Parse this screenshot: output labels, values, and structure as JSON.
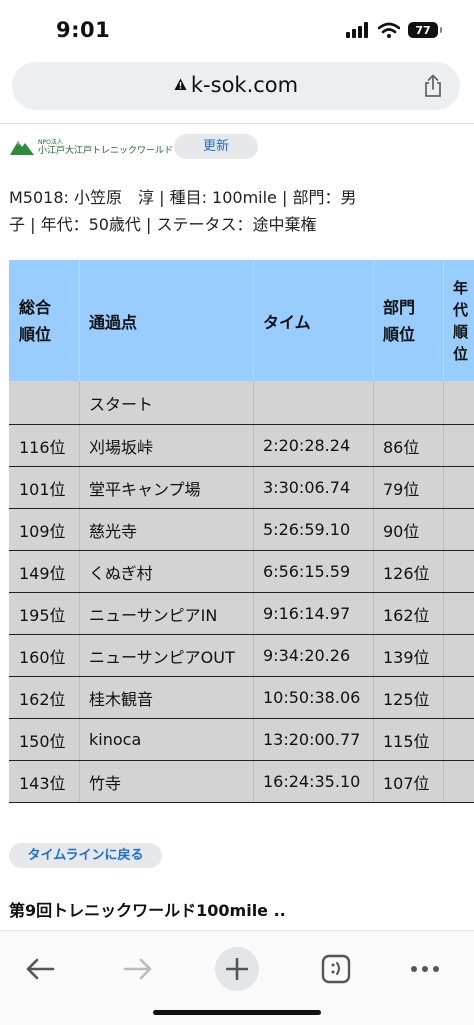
{
  "status_bar": {
    "time": "9:01",
    "battery": "77"
  },
  "browser": {
    "url": "k-sok.com"
  },
  "site": {
    "logo_small": "NPO法人",
    "logo_main": "小江戸大江戸トレニックワールド",
    "update_label": "更新"
  },
  "runner": {
    "line1": "M5018: 小笠原　淳 | 種目: 100mile | 部門：男",
    "line2": "子 | 年代：50歳代 | ステータス：途中棄権"
  },
  "table": {
    "headers": {
      "rank_l1": "総合",
      "rank_l2": "順位",
      "point": "通過点",
      "time": "タイム",
      "div_l1": "部門",
      "div_l2": "順位",
      "age_l1": "年",
      "age_l2": "代",
      "age_l3": "順",
      "age_l4": "位"
    },
    "start": "スタート",
    "rows": [
      {
        "rank": "116位",
        "point": "刈場坂峠",
        "time": "2:20:28.24",
        "division_rank": "86位"
      },
      {
        "rank": "101位",
        "point": "堂平キャンプ場",
        "time": "3:30:06.74",
        "division_rank": "79位"
      },
      {
        "rank": "109位",
        "point": "慈光寺",
        "time": "5:26:59.10",
        "division_rank": "90位"
      },
      {
        "rank": "149位",
        "point": "くぬぎ村",
        "time": "6:56:15.59",
        "division_rank": "126位"
      },
      {
        "rank": "195位",
        "point": "ニューサンピアIN",
        "time": "9:16:14.97",
        "division_rank": "162位"
      },
      {
        "rank": "160位",
        "point": "ニューサンピアOUT",
        "time": "9:34:20.26",
        "division_rank": "139位"
      },
      {
        "rank": "162位",
        "point": "桂木観音",
        "time": "10:50:38.06",
        "division_rank": "125位"
      },
      {
        "rank": "150位",
        "point": "kinoca",
        "time": "13:20:00.77",
        "division_rank": "115位"
      },
      {
        "rank": "143位",
        "point": "竹寺",
        "time": "16:24:35.10",
        "division_rank": "107位"
      }
    ]
  },
  "back_button": "タイムラインに戻る",
  "event_title": "第9回トレニックワールド100mile ..",
  "toolbar_icons": [
    "back-icon",
    "forward-icon",
    "new-tab-icon",
    "tabs-icon",
    "more-icon"
  ],
  "colors": {
    "header_bg": "#99ccff",
    "row_bg": "#d3d3d3",
    "link": "#1a6fd6"
  }
}
